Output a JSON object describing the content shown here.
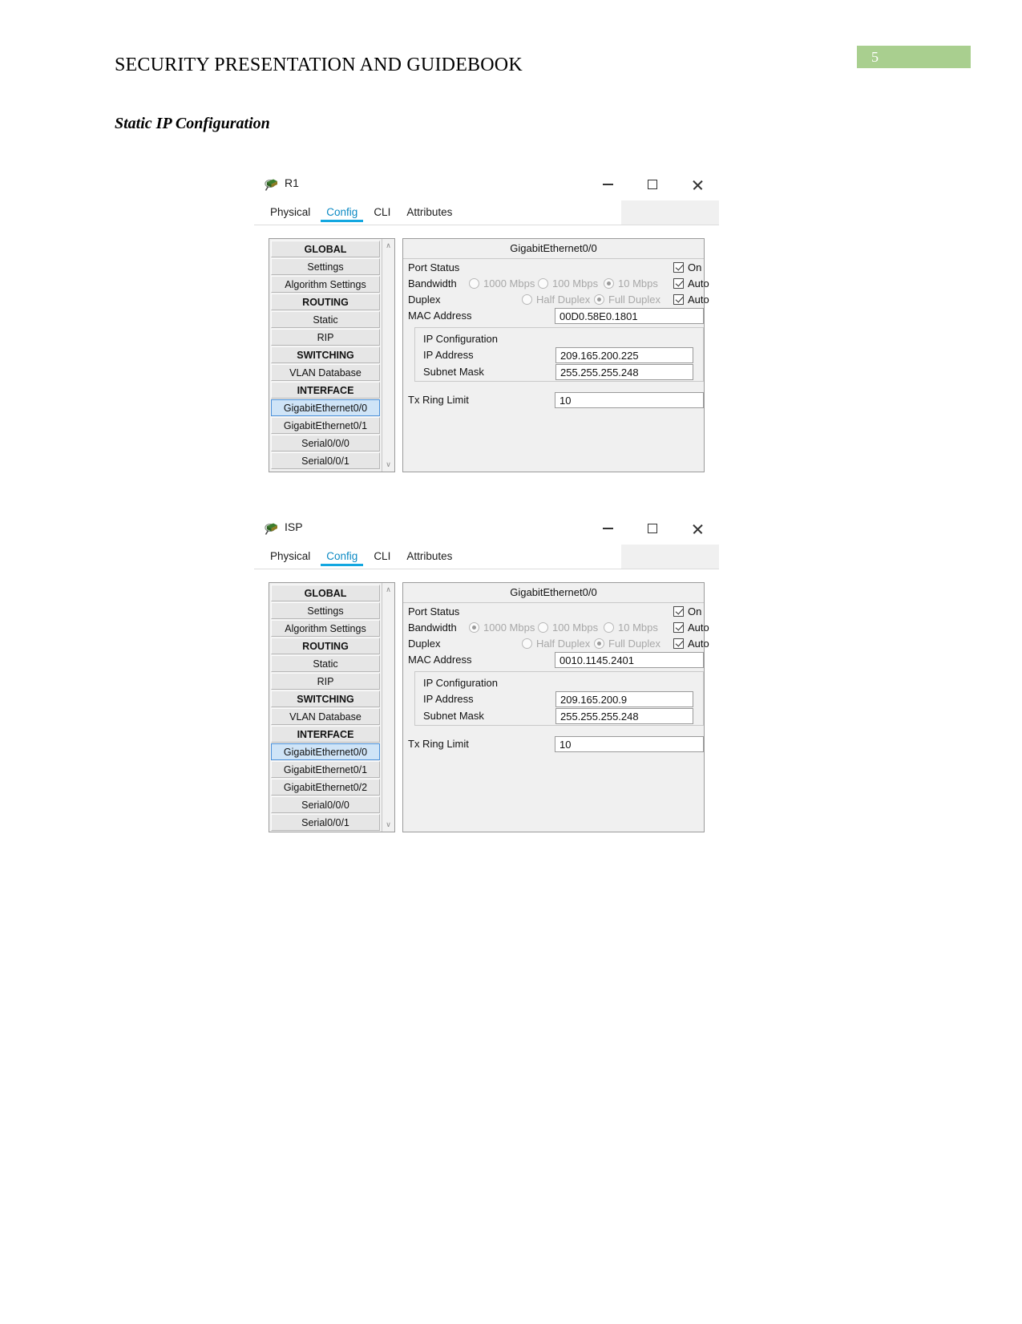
{
  "document": {
    "header_title": "SECURITY PRESENTATION AND GUIDEBOOK",
    "page_number": "5",
    "page_badge_color": "#a9cf8f",
    "section_title": "Static IP Configuration"
  },
  "windows": [
    {
      "title": "R1",
      "titlebar_icon": "packet-tracer-router-icon",
      "controls": {
        "minimize": "minimize-icon",
        "maximize": "maximize-icon",
        "close": "close-icon"
      },
      "tabs": [
        {
          "label": "Physical",
          "active": false
        },
        {
          "label": "Config",
          "active": true
        },
        {
          "label": "CLI",
          "active": false
        },
        {
          "label": "Attributes",
          "active": false
        }
      ],
      "active_tab_color": "#13a7e0",
      "tree": [
        {
          "label": "GLOBAL",
          "type": "header",
          "selected": false
        },
        {
          "label": "Settings",
          "type": "item",
          "selected": false
        },
        {
          "label": "Algorithm Settings",
          "type": "item",
          "selected": false
        },
        {
          "label": "ROUTING",
          "type": "header",
          "selected": false
        },
        {
          "label": "Static",
          "type": "item",
          "selected": false
        },
        {
          "label": "RIP",
          "type": "item",
          "selected": false
        },
        {
          "label": "SWITCHING",
          "type": "header",
          "selected": false
        },
        {
          "label": "VLAN Database",
          "type": "item",
          "selected": false
        },
        {
          "label": "INTERFACE",
          "type": "header",
          "selected": false
        },
        {
          "label": "GigabitEthernet0/0",
          "type": "item",
          "selected": true
        },
        {
          "label": "GigabitEthernet0/1",
          "type": "item",
          "selected": false
        },
        {
          "label": "Serial0/0/0",
          "type": "item",
          "selected": false
        },
        {
          "label": "Serial0/0/1",
          "type": "item",
          "selected": false
        }
      ],
      "config": {
        "panel_title": "GigabitEthernet0/0",
        "port_status": {
          "label": "Port Status",
          "checkbox_label": "On",
          "checked": true
        },
        "bandwidth": {
          "label": "Bandwidth",
          "options": [
            {
              "label": "1000 Mbps",
              "selected": false
            },
            {
              "label": "100 Mbps",
              "selected": false
            },
            {
              "label": "10 Mbps",
              "selected": true
            }
          ],
          "auto_label": "Auto",
          "auto_checked": true
        },
        "duplex": {
          "label": "Duplex",
          "options": [
            {
              "label": "Half Duplex",
              "selected": false
            },
            {
              "label": "Full Duplex",
              "selected": true
            }
          ],
          "auto_label": "Auto",
          "auto_checked": true
        },
        "mac": {
          "label": "MAC Address",
          "value": "00D0.58E0.1801"
        },
        "ip_configuration": {
          "group_label": "IP Configuration",
          "ip_address": {
            "label": "IP Address",
            "value": "209.165.200.225"
          },
          "subnet_mask": {
            "label": "Subnet Mask",
            "value": "255.255.255.248"
          }
        },
        "tx_ring_limit": {
          "label": "Tx Ring Limit",
          "value": "10"
        }
      }
    },
    {
      "title": "ISP",
      "titlebar_icon": "packet-tracer-router-icon",
      "controls": {
        "minimize": "minimize-icon",
        "maximize": "maximize-icon",
        "close": "close-icon"
      },
      "tabs": [
        {
          "label": "Physical",
          "active": false
        },
        {
          "label": "Config",
          "active": true
        },
        {
          "label": "CLI",
          "active": false
        },
        {
          "label": "Attributes",
          "active": false
        }
      ],
      "active_tab_color": "#13a7e0",
      "tree": [
        {
          "label": "GLOBAL",
          "type": "header",
          "selected": false
        },
        {
          "label": "Settings",
          "type": "item",
          "selected": false
        },
        {
          "label": "Algorithm Settings",
          "type": "item",
          "selected": false
        },
        {
          "label": "ROUTING",
          "type": "header",
          "selected": false
        },
        {
          "label": "Static",
          "type": "item",
          "selected": false
        },
        {
          "label": "RIP",
          "type": "item",
          "selected": false
        },
        {
          "label": "SWITCHING",
          "type": "header",
          "selected": false
        },
        {
          "label": "VLAN Database",
          "type": "item",
          "selected": false
        },
        {
          "label": "INTERFACE",
          "type": "header",
          "selected": false
        },
        {
          "label": "GigabitEthernet0/0",
          "type": "item",
          "selected": true
        },
        {
          "label": "GigabitEthernet0/1",
          "type": "item",
          "selected": false
        },
        {
          "label": "GigabitEthernet0/2",
          "type": "item",
          "selected": false
        },
        {
          "label": "Serial0/0/0",
          "type": "item",
          "selected": false
        },
        {
          "label": "Serial0/0/1",
          "type": "item",
          "selected": false
        }
      ],
      "config": {
        "panel_title": "GigabitEthernet0/0",
        "port_status": {
          "label": "Port Status",
          "checkbox_label": "On",
          "checked": true
        },
        "bandwidth": {
          "label": "Bandwidth",
          "options": [
            {
              "label": "1000 Mbps",
              "selected": true
            },
            {
              "label": "100 Mbps",
              "selected": false
            },
            {
              "label": "10 Mbps",
              "selected": false
            }
          ],
          "auto_label": "Auto",
          "auto_checked": true
        },
        "duplex": {
          "label": "Duplex",
          "options": [
            {
              "label": "Half Duplex",
              "selected": false
            },
            {
              "label": "Full Duplex",
              "selected": true
            }
          ],
          "auto_label": "Auto",
          "auto_checked": true
        },
        "mac": {
          "label": "MAC Address",
          "value": "0010.1145.2401"
        },
        "ip_configuration": {
          "group_label": "IP Configuration",
          "ip_address": {
            "label": "IP Address",
            "value": "209.165.200.9"
          },
          "subnet_mask": {
            "label": "Subnet Mask",
            "value": "255.255.255.248"
          }
        },
        "tx_ring_limit": {
          "label": "Tx Ring Limit",
          "value": "10"
        }
      }
    }
  ]
}
